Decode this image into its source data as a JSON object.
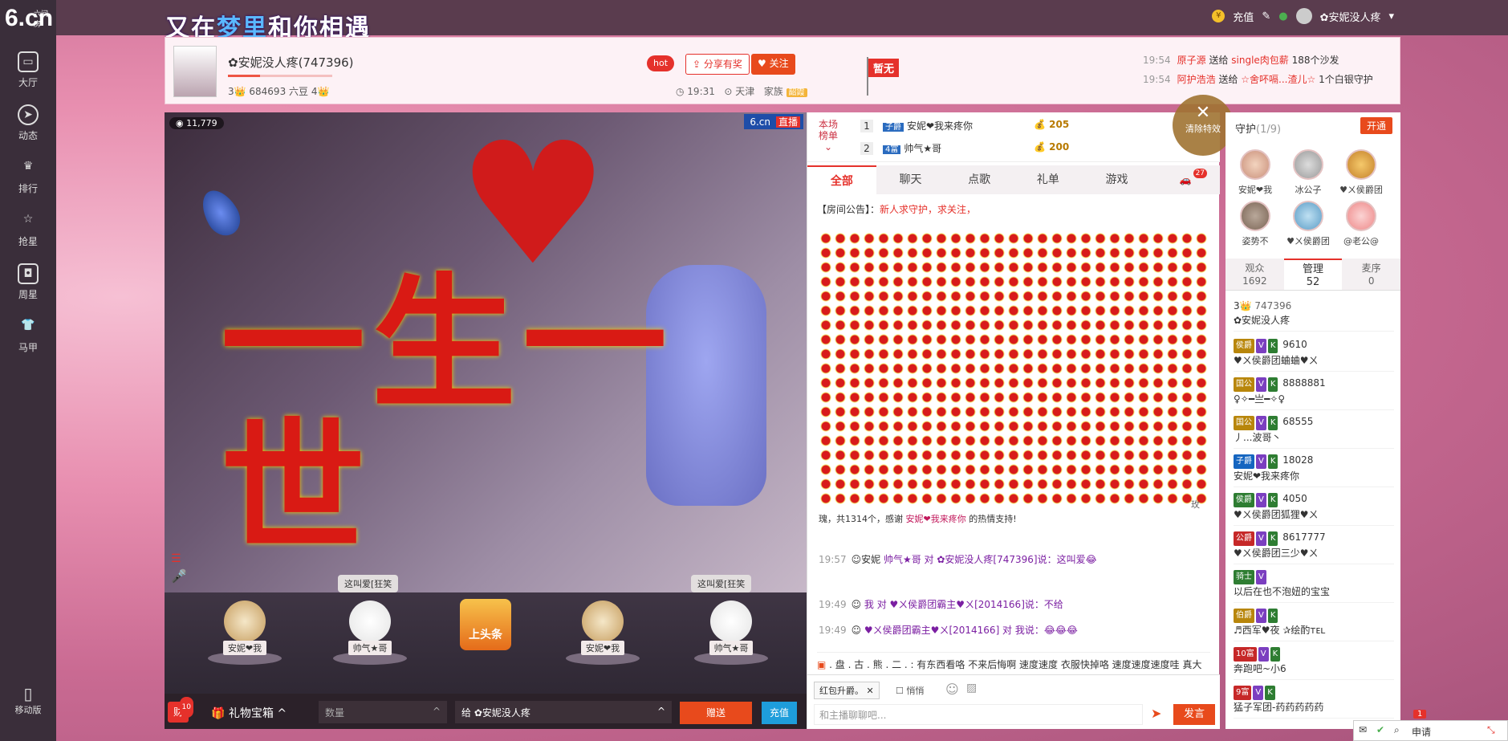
{
  "brand": {
    "logo_main": "6.cn",
    "logo_sub": "六间房"
  },
  "nav": [
    {
      "label": "大厅",
      "icon": "tv-icon"
    },
    {
      "label": "动态",
      "icon": "compass-icon"
    },
    {
      "label": "排行",
      "icon": "crown-icon"
    },
    {
      "label": "抢星",
      "icon": "star-icon"
    },
    {
      "label": "周星",
      "icon": "bag-icon"
    },
    {
      "label": "马甲",
      "icon": "shirt-icon"
    }
  ],
  "mobile_label": "移动版",
  "topbar": {
    "slogan_pre": "又在",
    "slogan_mid": "梦里",
    "slogan_post": "和你相遇",
    "recharge": "充值",
    "username": "✿安妮没人疼"
  },
  "anchor": {
    "name": "✿安妮没人疼(747396)",
    "stats": "3👑 684693 六豆 4👑",
    "hot": "hot",
    "share": "分享有奖",
    "follow": "关注",
    "time": "19:31",
    "city": "天津",
    "family": "家族",
    "family_tag": "韶霞",
    "flag": "暂无"
  },
  "feed": [
    {
      "time": "19:54",
      "from": "原子源",
      "action": "送给",
      "to": "single肉包薪",
      "gift": "188个沙发"
    },
    {
      "time": "19:54",
      "from": "阿护浩浩",
      "action": "送给",
      "to": "☆舍吥嗝...渣儿☆",
      "gift": "1个白银守护"
    }
  ],
  "video": {
    "viewers": "11,779",
    "site": "6.cn",
    "live": "直播"
  },
  "seats": [
    {
      "name": "安妮❤我",
      "bubble": ""
    },
    {
      "name": "帅气★哥",
      "bubble": "这叫爱[狂笑"
    },
    {
      "name": "上头条",
      "bubble": ""
    },
    {
      "name": "安妮❤我",
      "bubble": ""
    },
    {
      "name": "帅气★哥",
      "bubble": "这叫爱[狂笑"
    }
  ],
  "toolbar": {
    "cash_badge": "10",
    "cash": "财",
    "giftbox": "礼物宝箱",
    "qty_placeholder": "数量",
    "to": "给 ✿安妮没人疼",
    "send": "赠送",
    "recharge": "充值"
  },
  "rank": {
    "label1": "本场",
    "label2": "榜单",
    "rows": [
      {
        "n": "1",
        "lv": "子爵",
        "name": "安妮❤我来疼你",
        "amt": "205"
      },
      {
        "n": "2",
        "lv": "4富",
        "name": "帅气★哥",
        "amt": "200"
      }
    ]
  },
  "tabs": [
    "全部",
    "聊天",
    "点歌",
    "礼单",
    "游戏"
  ],
  "car_badge": "27",
  "notice": {
    "label": "【房间公告】：",
    "text": "新人求守护，求关注，"
  },
  "rose_text": {
    "pre": "瑰，共1314个，感谢",
    "who": "安妮❤我来疼你",
    "post": "的热情支持!",
    "tail": "玫"
  },
  "messages": [
    {
      "time": "19:57",
      "head": "安妮",
      "text": "帅气★哥 对 ✿安妮没人疼[747396]说：这叫爱😂"
    },
    {
      "time": "19:49",
      "head": "",
      "text": "我 对 ♥ㄨ侯爵团霸主♥ㄨ[2014166]说：不给"
    },
    {
      "time": "19:49",
      "head": "",
      "text": "♥ㄨ侯爵团霸主♥ㄨ[2014166] 对 我说：😂😂😂"
    }
  ],
  "broadcast": ". 盘 . 古 . 熊 . 二 . : 有东西看咯 不来后悔啊 速度速度 衣服快掉咯 速度速度速度哇 真大",
  "input": {
    "redtag": "红包升爵。",
    "quiet": "悄悄",
    "placeholder": "和主播聊聊吧...",
    "speak": "发言"
  },
  "clear_fx": "清除特效",
  "guard": {
    "title": "守护",
    "count": "(1/9)",
    "open": "开通",
    "avatars": [
      "安妮❤我",
      "冰公子",
      "♥ㄨ侯爵团",
      "姿势不",
      "♥ㄨ侯爵团",
      "@老公@"
    ]
  },
  "user_tabs": [
    {
      "label": "观众",
      "n": "1692"
    },
    {
      "label": "管理",
      "n": "52"
    },
    {
      "label": "麦序",
      "n": "0"
    }
  ],
  "users": [
    {
      "badges": [],
      "id": "747396",
      "name": "✿安妮没人疼",
      "lvl": "3👑"
    },
    {
      "badges": [
        "侯爵",
        "V",
        "K"
      ],
      "id": "9610",
      "name": "♥ㄨ侯爵团蛐蛐♥ㄨ"
    },
    {
      "badges": [
        "国公",
        "V",
        "K"
      ],
      "id": "8888881",
      "name": "♀✧━亗━✧♀"
    },
    {
      "badges": [
        "国公",
        "V",
        "K"
      ],
      "id": "68555",
      "name": "丿...波哥丶"
    },
    {
      "badges": [
        "子爵",
        "V",
        "K"
      ],
      "id": "18028",
      "name": "安妮❤我来疼你"
    },
    {
      "badges": [
        "侯爵",
        "V",
        "K"
      ],
      "id": "4050",
      "name": "♥ㄨ侯爵团狐狸♥ㄨ"
    },
    {
      "badges": [
        "公爵",
        "V",
        "K"
      ],
      "id": "8617777",
      "name": "♥ㄨ侯爵团三少♥ㄨ"
    },
    {
      "badges": [
        "骑士",
        "V"
      ],
      "id": "",
      "name": "以后在也不泡妞的宝宝"
    },
    {
      "badges": [
        "伯爵",
        "V",
        "K"
      ],
      "id": "",
      "name": "♬西军♥夜 ✰绘酌ᴛᴇʟ"
    },
    {
      "badges": [
        "10富",
        "V",
        "K"
      ],
      "id": "",
      "name": "奔跑吧~小6"
    },
    {
      "badges": [
        "9富",
        "V",
        "K"
      ],
      "id": "",
      "name": "猛子军团-药药药药药"
    }
  ],
  "dock": {
    "badge": "1",
    "label": "申请"
  }
}
